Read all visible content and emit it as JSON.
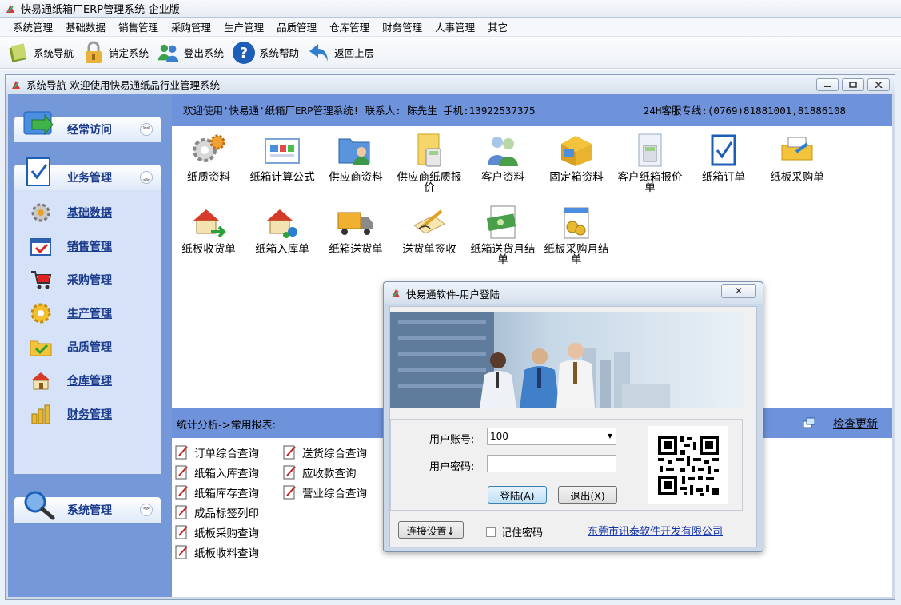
{
  "app": {
    "title": "快易通纸箱厂ERP管理系统-企业版"
  },
  "menu": [
    "系统管理",
    "基础数据",
    "销售管理",
    "采购管理",
    "生产管理",
    "品质管理",
    "仓库管理",
    "财务管理",
    "人事管理",
    "其它"
  ],
  "toolbar": {
    "nav": "系统导航",
    "lock": "销定系统",
    "logout": "登出系统",
    "help": "系统帮助",
    "back": "返回上层"
  },
  "inner_window": {
    "title": "系统导航-欢迎使用快易通纸品行业管理系统"
  },
  "left_panel": {
    "frequent": "经常访问",
    "business": "业务管理",
    "system": "系统管理",
    "items": [
      "基础数据",
      "销售管理",
      "采购管理",
      "生产管理",
      "品质管理",
      "仓库管理",
      "财务管理"
    ]
  },
  "banner": {
    "welcome": "欢迎使用'快易通'纸箱厂ERP管理系统! 联系人: 陈先生 手机:13922537375",
    "hotline": "24H客服专线:(0769)81881001,81886108"
  },
  "modules": {
    "row1": [
      "纸质资料",
      "纸箱计算公式",
      "供应商资料",
      "供应商纸质报价",
      "客户资料",
      "固定箱资料",
      "客户纸箱报价单",
      "纸箱订单",
      "纸板采购单"
    ],
    "row2": [
      "纸板收货单",
      "纸箱入库单",
      "纸箱送货单",
      "送货单签收",
      "纸箱送货月结单",
      "纸板采购月结单"
    ]
  },
  "reports": {
    "header": "统计分析->常用报表:",
    "update": "检查更新",
    "col1": [
      "订单综合查询",
      "纸箱入库查询",
      "纸箱库存查询",
      "成品标签列印",
      "纸板采购查询",
      "纸板收料查询"
    ],
    "col2": [
      "送货综合查询",
      "应收款查询",
      "营业综合查询"
    ]
  },
  "login": {
    "title": "快易通软件-用户登陆",
    "account_label": "用户账号:",
    "account_value": "100",
    "password_label": "用户密码:",
    "login_btn": "登陆(A)",
    "exit_btn": "退出(X)",
    "connect_btn": "连接设置↓",
    "remember": "记住密码",
    "company": "东莞市讯泰软件开发有限公司",
    "close": "✕"
  },
  "colors": {
    "panel_blue": "#7598d8",
    "banner_blue": "#6f93db",
    "link_blue": "#1533a8"
  }
}
